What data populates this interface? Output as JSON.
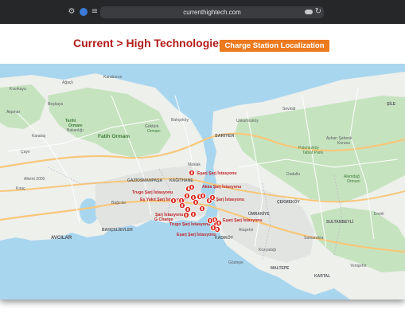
{
  "browser": {
    "url": "currenthightech.com"
  },
  "header": {
    "brand_title": "Current > High Technologies",
    "product_label": "Charge Station Localization"
  },
  "colors": {
    "brand": "#b21a1a",
    "badge": "#ec7a1e",
    "marker": "#d93025",
    "water": "#a9d6ef",
    "land": "#eef0ec",
    "forest": "#c6e3bf",
    "highway": "#f7c77a"
  },
  "map": {
    "places": {
      "sariyer": "SARIYER",
      "tarihi_ormani": "Tarihi\nOrmanı",
      "bakanligi": "Bakanlığı",
      "fatih_ormani": "Fatih Ormanı",
      "gokturk": "Göktürk",
      "ormani": "Ormanı",
      "bahcekoy": "Bahçeköy",
      "uskumruköy": "Uskumruköy",
      "sevindi": "Sevindi",
      "ayhan_sahenk": "Ayhan Şahenk",
      "korusu": "Korusu",
      "polonezkoy": "Polonezköy",
      "tabiat_parki": "Tabiat Parkı",
      "alemdag": "Alemdağ",
      "ormani2": "Ormanı",
      "agacli": "Ağaçlı",
      "kisirkaya": "Kısırkaya",
      "beskaya": "Beşkaya",
      "karaburun": "Karaburun",
      "karatas": "Karataş",
      "cayir": "Çayır",
      "akpinar": "Akpınar",
      "kilicli": "Kılıçlı",
      "maslak": "Maslak",
      "alkent": "Alkent 2000",
      "avcilar": "AVCILAR",
      "bahcelievler": "BAHÇELİEVLER",
      "gaziosmanpasa": "GAZİOSMANPAŞA",
      "kiraç": "Kıraç",
      "bagcilar": "Bağcılar",
      "kagithane": "KAĞITHANE",
      "atasehir": "Ataşehir",
      "cekmekoy": "ÇEKMEKÖY",
      "umraniye": "ÜMRANİYE",
      "kadikoy": "KADIKÖY",
      "gozrepe": "Göztepe",
      "maltepe": "MALTEPE",
      "kartal": "KARTAL",
      "sultanbeyli": "SULTANBEYLİ",
      "sile": "ŞİLE",
      "kozyatagi": "Kozyatağı",
      "samandira": "Samandıra",
      "yenisehir": "Yenişehir",
      "dudullu": "Dudullu",
      "emirli": "Emirli",
      "istanbul": "İstanbul"
    },
    "station_labels": [
      "Eşarj Şarj İstasyonu",
      "Akka Şarj İstasyonu",
      "Trugo Şarj İstasyonu",
      "Eş Yakıt Şarj İstasyonu",
      "ZES Şarj İstasyonu",
      "Şarj İstasyonu",
      "G Charge",
      "Eşarj Şarj İstasyonu",
      "Trugo Şarj İstasyonu",
      "Eşarj Şarj İstasyonu"
    ],
    "marker_count": 23
  }
}
